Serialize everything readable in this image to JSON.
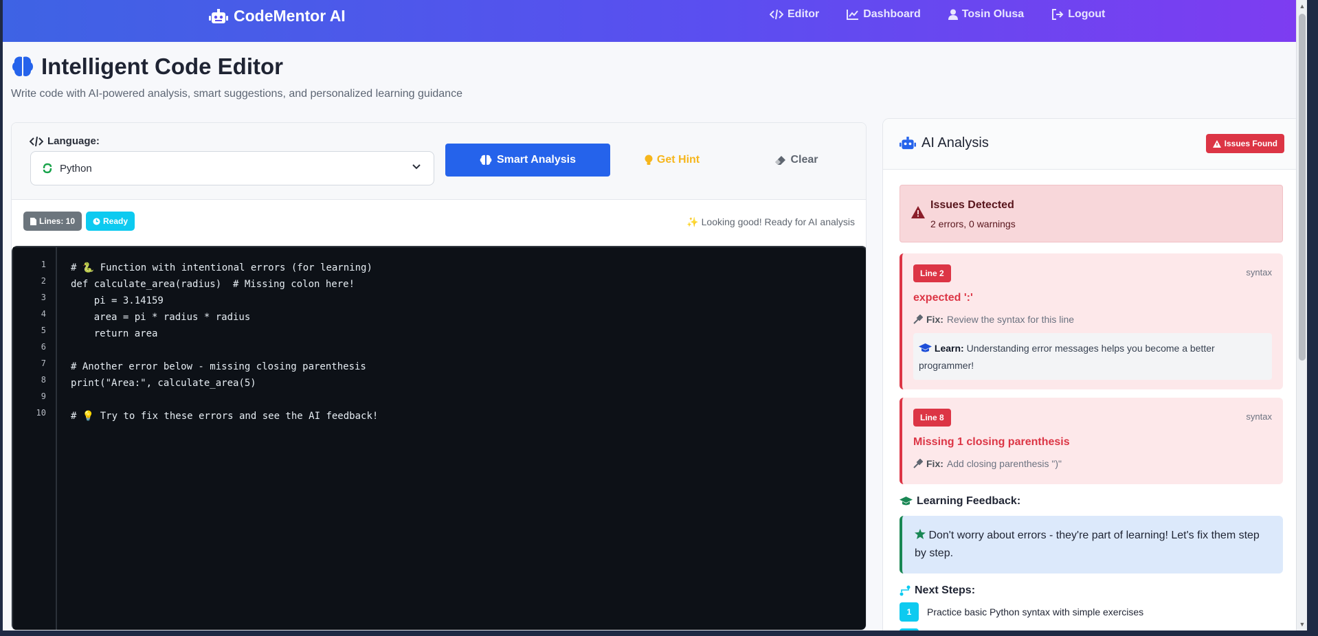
{
  "brand": {
    "name": "CodeMentor AI"
  },
  "nav": {
    "editor": "Editor",
    "dashboard": "Dashboard",
    "user": "Tosin Olusa",
    "logout": "Logout"
  },
  "page": {
    "title": "Intelligent Code Editor",
    "subtitle": "Write code with AI-powered analysis, smart suggestions, and personalized learning guidance"
  },
  "editor": {
    "language_label": "Language:",
    "language_value": "Python",
    "smart_analysis": "Smart Analysis",
    "get_hint": "Get Hint",
    "clear": "Clear",
    "lines_badge": "Lines: 10",
    "ready_badge": "Ready",
    "status_message": "✨ Looking good! Ready for AI analysis",
    "line_numbers": [
      "1",
      "2",
      "3",
      "4",
      "5",
      "6",
      "7",
      "8",
      "9",
      "10"
    ],
    "code_lines": [
      "# 🐍 Function with intentional errors (for learning)",
      "def calculate_area(radius)  # Missing colon here!",
      "    pi = 3.14159",
      "    area = pi * radius * radius",
      "    return area",
      "",
      "# Another error below - missing closing parenthesis",
      "print(\"Area:\", calculate_area(5)",
      "",
      "# 💡 Try to fix these errors and see the AI feedback!"
    ]
  },
  "ai": {
    "title": "AI Analysis",
    "status_badge": "Issues Found",
    "alert_title": "Issues Detected",
    "alert_sub": "2 errors, 0 warnings",
    "issues": [
      {
        "line": "Line 2",
        "type": "syntax",
        "title": "expected ':'",
        "fix_label": "Fix:",
        "fix_text": "Review the syntax for this line",
        "learn_label": "Learn:",
        "learn_text": "Understanding error messages helps you become a better programmer!"
      },
      {
        "line": "Line 8",
        "type": "syntax",
        "title": "Missing 1 closing parenthesis",
        "fix_label": "Fix:",
        "fix_text": "Add closing parenthesis \")\""
      }
    ],
    "learning_title": "Learning Feedback:",
    "learning_text": "Don't worry about errors - they're part of learning! Let's fix them step by step.",
    "next_steps_title": "Next Steps:",
    "steps": [
      {
        "num": "1",
        "text": "Practice basic Python syntax with simple exercises"
      }
    ]
  },
  "colors": {
    "primary": "#2563eb",
    "danger": "#dc3545",
    "info": "#0dcaf0",
    "warning": "#f6b61c",
    "success": "#198754"
  }
}
